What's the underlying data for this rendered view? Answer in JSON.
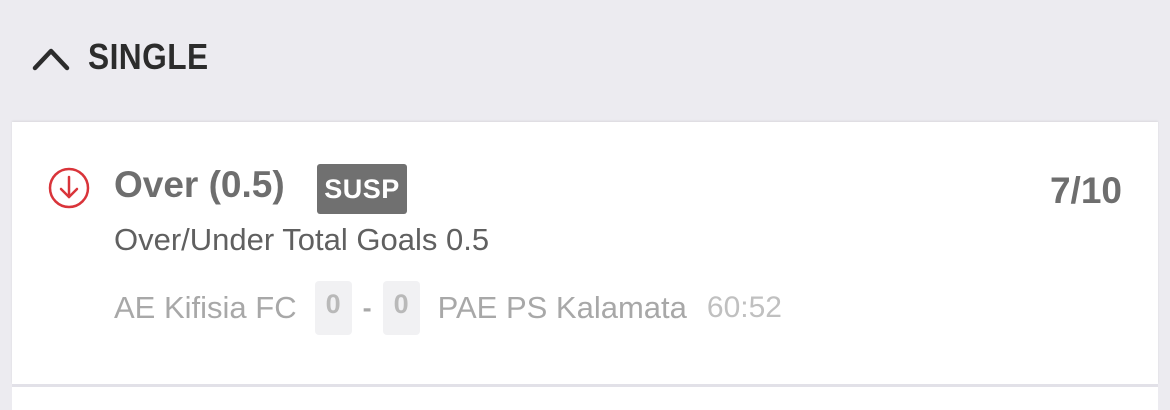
{
  "section": {
    "title": "SINGLE",
    "toggle_icon": "chevron-up-icon"
  },
  "bet": {
    "status_icon": "arrow-down-circle-icon",
    "status_icon_color": "#d9343a",
    "selection": "Over (0.5)",
    "badge": "SUSP",
    "odds": "7/10",
    "market": "Over/Under Total Goals 0.5",
    "event": {
      "home_team": "AE Kifisia FC",
      "home_score": "0",
      "separator": "-",
      "away_score": "0",
      "away_team": "PAE PS Kalamata",
      "clock": "60:52"
    }
  }
}
